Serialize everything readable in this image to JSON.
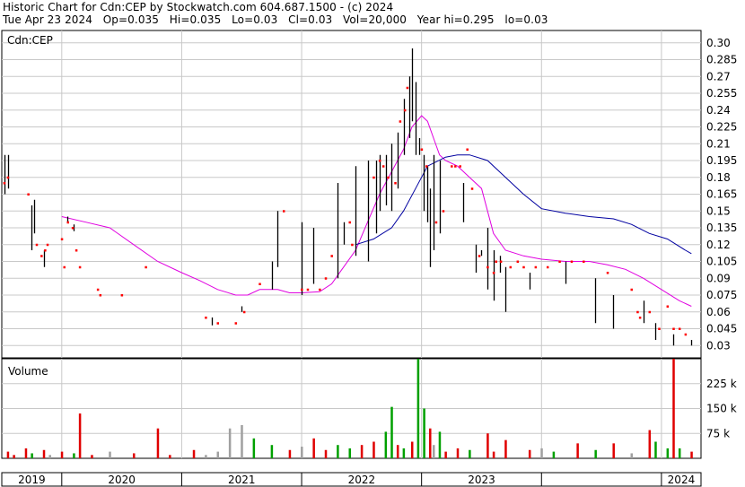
{
  "header": {
    "line1": "Historic Chart for Cdn:CEP by Stockwatch.com 604.687.1500 - (c) 2024",
    "line2": "Tue Apr 23 2024   Op=0.035   Hi=0.035   Lo=0.03   Cl=0.03   Vol=20,000   Year hi=0.295   lo=0.03"
  },
  "chart_data": [
    {
      "type": "ohlc",
      "label": "Cdn:CEP",
      "y_ticks": [
        "0.30",
        "0.285",
        "0.27",
        "0.255",
        "0.24",
        "0.225",
        "0.21",
        "0.195",
        "0.18",
        "0.165",
        "0.15",
        "0.135",
        "0.12",
        "0.105",
        "0.09",
        "0.075",
        "0.06",
        "0.045",
        "0.03"
      ],
      "ylim": [
        0.019,
        0.311
      ],
      "x_ticks": [
        "2019",
        "2020",
        "2021",
        "2022",
        "2023",
        "2024"
      ],
      "x_tick_t": [
        2019.0,
        2020.0,
        2021.0,
        2022.0,
        2023.0,
        2024.0
      ],
      "xlim": [
        2018.5,
        2024.33
      ],
      "colors": {
        "bar": "#000000",
        "dot": "#ff0000",
        "ma_short": "#e000e0",
        "ma_long": "#0000a0",
        "grid": "#c8c8c8"
      },
      "bars": [
        [
          2018.52,
          0.165,
          0.2
        ],
        [
          2018.55,
          0.17,
          0.2
        ],
        [
          2018.75,
          0.115,
          0.155
        ],
        [
          2018.77,
          0.13,
          0.16
        ],
        [
          2018.85,
          0.1,
          0.115
        ],
        [
          2019.05,
          0.14,
          0.145
        ],
        [
          2019.1,
          0.132,
          0.138
        ],
        [
          2020.25,
          0.048,
          0.055
        ],
        [
          2020.5,
          0.06,
          0.065
        ],
        [
          2020.75,
          0.08,
          0.105
        ],
        [
          2020.8,
          0.1,
          0.15
        ],
        [
          2021.0,
          0.075,
          0.14
        ],
        [
          2021.1,
          0.085,
          0.135
        ],
        [
          2021.3,
          0.09,
          0.175
        ],
        [
          2021.35,
          0.12,
          0.14
        ],
        [
          2021.45,
          0.11,
          0.19
        ],
        [
          2021.55,
          0.105,
          0.195
        ],
        [
          2021.62,
          0.13,
          0.195
        ],
        [
          2021.65,
          0.15,
          0.2
        ],
        [
          2021.7,
          0.155,
          0.2
        ],
        [
          2021.75,
          0.15,
          0.21
        ],
        [
          2021.8,
          0.17,
          0.22
        ],
        [
          2021.85,
          0.2,
          0.25
        ],
        [
          2021.9,
          0.215,
          0.27
        ],
        [
          2021.92,
          0.23,
          0.295
        ],
        [
          2021.95,
          0.2,
          0.265
        ],
        [
          2021.98,
          0.2,
          0.215
        ],
        [
          2022.02,
          0.15,
          0.2
        ],
        [
          2022.05,
          0.14,
          0.19
        ],
        [
          2022.07,
          0.1,
          0.17
        ],
        [
          2022.1,
          0.115,
          0.2
        ],
        [
          2022.15,
          0.13,
          0.195
        ],
        [
          2022.35,
          0.14,
          0.175
        ],
        [
          2022.45,
          0.095,
          0.12
        ],
        [
          2022.5,
          0.11,
          0.115
        ],
        [
          2022.55,
          0.08,
          0.135
        ],
        [
          2022.6,
          0.07,
          0.115
        ],
        [
          2022.65,
          0.095,
          0.11
        ],
        [
          2022.7,
          0.06,
          0.1
        ],
        [
          2022.9,
          0.08,
          0.095
        ],
        [
          2023.2,
          0.085,
          0.105
        ],
        [
          2023.45,
          0.05,
          0.09
        ],
        [
          2023.6,
          0.045,
          0.075
        ],
        [
          2023.85,
          0.05,
          0.07
        ],
        [
          2023.95,
          0.035,
          0.05
        ],
        [
          2024.1,
          0.03,
          0.04
        ],
        [
          2024.25,
          0.03,
          0.035
        ]
      ],
      "dots": [
        [
          2018.52,
          0.175
        ],
        [
          2018.55,
          0.18
        ],
        [
          2018.72,
          0.165
        ],
        [
          2018.79,
          0.12
        ],
        [
          2018.83,
          0.11
        ],
        [
          2018.86,
          0.115
        ],
        [
          2018.88,
          0.12
        ],
        [
          2019.0,
          0.125
        ],
        [
          2019.02,
          0.1
        ],
        [
          2019.05,
          0.14
        ],
        [
          2019.09,
          0.135
        ],
        [
          2019.12,
          0.115
        ],
        [
          2019.15,
          0.1
        ],
        [
          2019.3,
          0.08
        ],
        [
          2019.32,
          0.075
        ],
        [
          2019.5,
          0.075
        ],
        [
          2019.7,
          0.1
        ],
        [
          2020.2,
          0.055
        ],
        [
          2020.3,
          0.05
        ],
        [
          2020.45,
          0.05
        ],
        [
          2020.52,
          0.06
        ],
        [
          2020.65,
          0.085
        ],
        [
          2020.85,
          0.15
        ],
        [
          2021.0,
          0.08
        ],
        [
          2021.05,
          0.08
        ],
        [
          2021.15,
          0.08
        ],
        [
          2021.2,
          0.09
        ],
        [
          2021.25,
          0.11
        ],
        [
          2021.4,
          0.14
        ],
        [
          2021.42,
          0.12
        ],
        [
          2021.6,
          0.18
        ],
        [
          2021.65,
          0.195
        ],
        [
          2021.68,
          0.19
        ],
        [
          2021.72,
          0.18
        ],
        [
          2021.78,
          0.175
        ],
        [
          2021.82,
          0.23
        ],
        [
          2021.86,
          0.24
        ],
        [
          2021.88,
          0.26
        ],
        [
          2022.0,
          0.205
        ],
        [
          2022.04,
          0.19
        ],
        [
          2022.12,
          0.14
        ],
        [
          2022.18,
          0.15
        ],
        [
          2022.25,
          0.19
        ],
        [
          2022.28,
          0.19
        ],
        [
          2022.32,
          0.19
        ],
        [
          2022.38,
          0.205
        ],
        [
          2022.42,
          0.17
        ],
        [
          2022.48,
          0.11
        ],
        [
          2022.55,
          0.1
        ],
        [
          2022.6,
          0.095
        ],
        [
          2022.62,
          0.105
        ],
        [
          2022.66,
          0.105
        ],
        [
          2022.74,
          0.1
        ],
        [
          2022.8,
          0.105
        ],
        [
          2022.85,
          0.1
        ],
        [
          2022.95,
          0.1
        ],
        [
          2023.05,
          0.1
        ],
        [
          2023.15,
          0.105
        ],
        [
          2023.25,
          0.105
        ],
        [
          2023.35,
          0.105
        ],
        [
          2023.55,
          0.095
        ],
        [
          2023.75,
          0.08
        ],
        [
          2023.8,
          0.06
        ],
        [
          2023.82,
          0.055
        ],
        [
          2023.9,
          0.06
        ],
        [
          2023.98,
          0.045
        ],
        [
          2024.05,
          0.065
        ],
        [
          2024.1,
          0.045
        ],
        [
          2024.15,
          0.045
        ],
        [
          2024.2,
          0.04
        ]
      ],
      "ma_short": [
        [
          2019.0,
          0.145
        ],
        [
          2019.2,
          0.14
        ],
        [
          2019.4,
          0.135
        ],
        [
          2019.6,
          0.12
        ],
        [
          2019.8,
          0.105
        ],
        [
          2020.0,
          0.095
        ],
        [
          2020.15,
          0.088
        ],
        [
          2020.3,
          0.08
        ],
        [
          2020.45,
          0.075
        ],
        [
          2020.55,
          0.075
        ],
        [
          2020.65,
          0.08
        ],
        [
          2020.8,
          0.08
        ],
        [
          2020.9,
          0.077
        ],
        [
          2021.0,
          0.077
        ],
        [
          2021.15,
          0.078
        ],
        [
          2021.25,
          0.085
        ],
        [
          2021.35,
          0.1
        ],
        [
          2021.45,
          0.115
        ],
        [
          2021.55,
          0.14
        ],
        [
          2021.65,
          0.165
        ],
        [
          2021.75,
          0.185
        ],
        [
          2021.85,
          0.205
        ],
        [
          2021.92,
          0.225
        ],
        [
          2022.0,
          0.235
        ],
        [
          2022.05,
          0.23
        ],
        [
          2022.1,
          0.215
        ],
        [
          2022.15,
          0.2
        ],
        [
          2022.2,
          0.195
        ],
        [
          2022.3,
          0.19
        ],
        [
          2022.4,
          0.18
        ],
        [
          2022.5,
          0.17
        ],
        [
          2022.6,
          0.13
        ],
        [
          2022.7,
          0.115
        ],
        [
          2022.85,
          0.11
        ],
        [
          2023.0,
          0.107
        ],
        [
          2023.2,
          0.105
        ],
        [
          2023.4,
          0.105
        ],
        [
          2023.55,
          0.102
        ],
        [
          2023.7,
          0.098
        ],
        [
          2023.85,
          0.09
        ],
        [
          2024.0,
          0.08
        ],
        [
          2024.15,
          0.07
        ],
        [
          2024.25,
          0.065
        ]
      ],
      "ma_long": [
        [
          2021.45,
          0.12
        ],
        [
          2021.6,
          0.125
        ],
        [
          2021.75,
          0.135
        ],
        [
          2021.85,
          0.15
        ],
        [
          2021.95,
          0.17
        ],
        [
          2022.05,
          0.19
        ],
        [
          2022.2,
          0.198
        ],
        [
          2022.3,
          0.2
        ],
        [
          2022.4,
          0.2
        ],
        [
          2022.55,
          0.195
        ],
        [
          2022.7,
          0.18
        ],
        [
          2022.85,
          0.165
        ],
        [
          2023.0,
          0.152
        ],
        [
          2023.2,
          0.148
        ],
        [
          2023.4,
          0.145
        ],
        [
          2023.6,
          0.143
        ],
        [
          2023.75,
          0.138
        ],
        [
          2023.9,
          0.13
        ],
        [
          2024.05,
          0.125
        ],
        [
          2024.2,
          0.115
        ],
        [
          2024.25,
          0.112
        ]
      ]
    },
    {
      "type": "volume_bar",
      "label": "Volume",
      "y_ticks": [
        "225 k",
        "150 k",
        "75 k"
      ],
      "y_tick_values": [
        225000,
        150000,
        75000
      ],
      "ylim": [
        0,
        300000
      ],
      "colors": {
        "up": "#00a000",
        "down": "#e00000",
        "flat": "#a0a0a0"
      },
      "bars": [
        [
          2018.55,
          20000,
          "down"
        ],
        [
          2018.6,
          10000,
          "down"
        ],
        [
          2018.7,
          30000,
          "down"
        ],
        [
          2018.75,
          15000,
          "up"
        ],
        [
          2018.85,
          25000,
          "down"
        ],
        [
          2018.9,
          10000,
          "flat"
        ],
        [
          2019.0,
          20000,
          "down"
        ],
        [
          2019.1,
          15000,
          "up"
        ],
        [
          2019.15,
          135000,
          "down"
        ],
        [
          2019.25,
          10000,
          "down"
        ],
        [
          2019.4,
          20000,
          "flat"
        ],
        [
          2019.6,
          15000,
          "down"
        ],
        [
          2019.8,
          90000,
          "down"
        ],
        [
          2019.9,
          10000,
          "down"
        ],
        [
          2020.1,
          25000,
          "down"
        ],
        [
          2020.2,
          10000,
          "flat"
        ],
        [
          2020.3,
          20000,
          "flat"
        ],
        [
          2020.4,
          90000,
          "flat"
        ],
        [
          2020.5,
          100000,
          "flat"
        ],
        [
          2020.6,
          60000,
          "up"
        ],
        [
          2020.75,
          40000,
          "up"
        ],
        [
          2020.9,
          25000,
          "down"
        ],
        [
          2021.0,
          35000,
          "flat"
        ],
        [
          2021.1,
          60000,
          "down"
        ],
        [
          2021.2,
          25000,
          "down"
        ],
        [
          2021.3,
          40000,
          "up"
        ],
        [
          2021.4,
          30000,
          "up"
        ],
        [
          2021.5,
          40000,
          "down"
        ],
        [
          2021.6,
          50000,
          "down"
        ],
        [
          2021.7,
          80000,
          "up"
        ],
        [
          2021.75,
          155000,
          "up"
        ],
        [
          2021.8,
          40000,
          "down"
        ],
        [
          2021.85,
          30000,
          "up"
        ],
        [
          2021.92,
          50000,
          "down"
        ],
        [
          2021.97,
          300000,
          "up"
        ],
        [
          2022.02,
          150000,
          "up"
        ],
        [
          2022.07,
          90000,
          "down"
        ],
        [
          2022.1,
          40000,
          "flat"
        ],
        [
          2022.15,
          80000,
          "up"
        ],
        [
          2022.2,
          20000,
          "down"
        ],
        [
          2022.3,
          30000,
          "down"
        ],
        [
          2022.4,
          25000,
          "up"
        ],
        [
          2022.55,
          75000,
          "down"
        ],
        [
          2022.6,
          20000,
          "down"
        ],
        [
          2022.7,
          55000,
          "down"
        ],
        [
          2022.9,
          25000,
          "down"
        ],
        [
          2023.0,
          30000,
          "flat"
        ],
        [
          2023.1,
          20000,
          "up"
        ],
        [
          2023.3,
          45000,
          "down"
        ],
        [
          2023.45,
          25000,
          "up"
        ],
        [
          2023.6,
          45000,
          "down"
        ],
        [
          2023.75,
          15000,
          "flat"
        ],
        [
          2023.9,
          85000,
          "down"
        ],
        [
          2023.95,
          50000,
          "up"
        ],
        [
          2024.05,
          30000,
          "up"
        ],
        [
          2024.1,
          300000,
          "down"
        ],
        [
          2024.15,
          30000,
          "up"
        ],
        [
          2024.25,
          20000,
          "down"
        ]
      ]
    }
  ]
}
